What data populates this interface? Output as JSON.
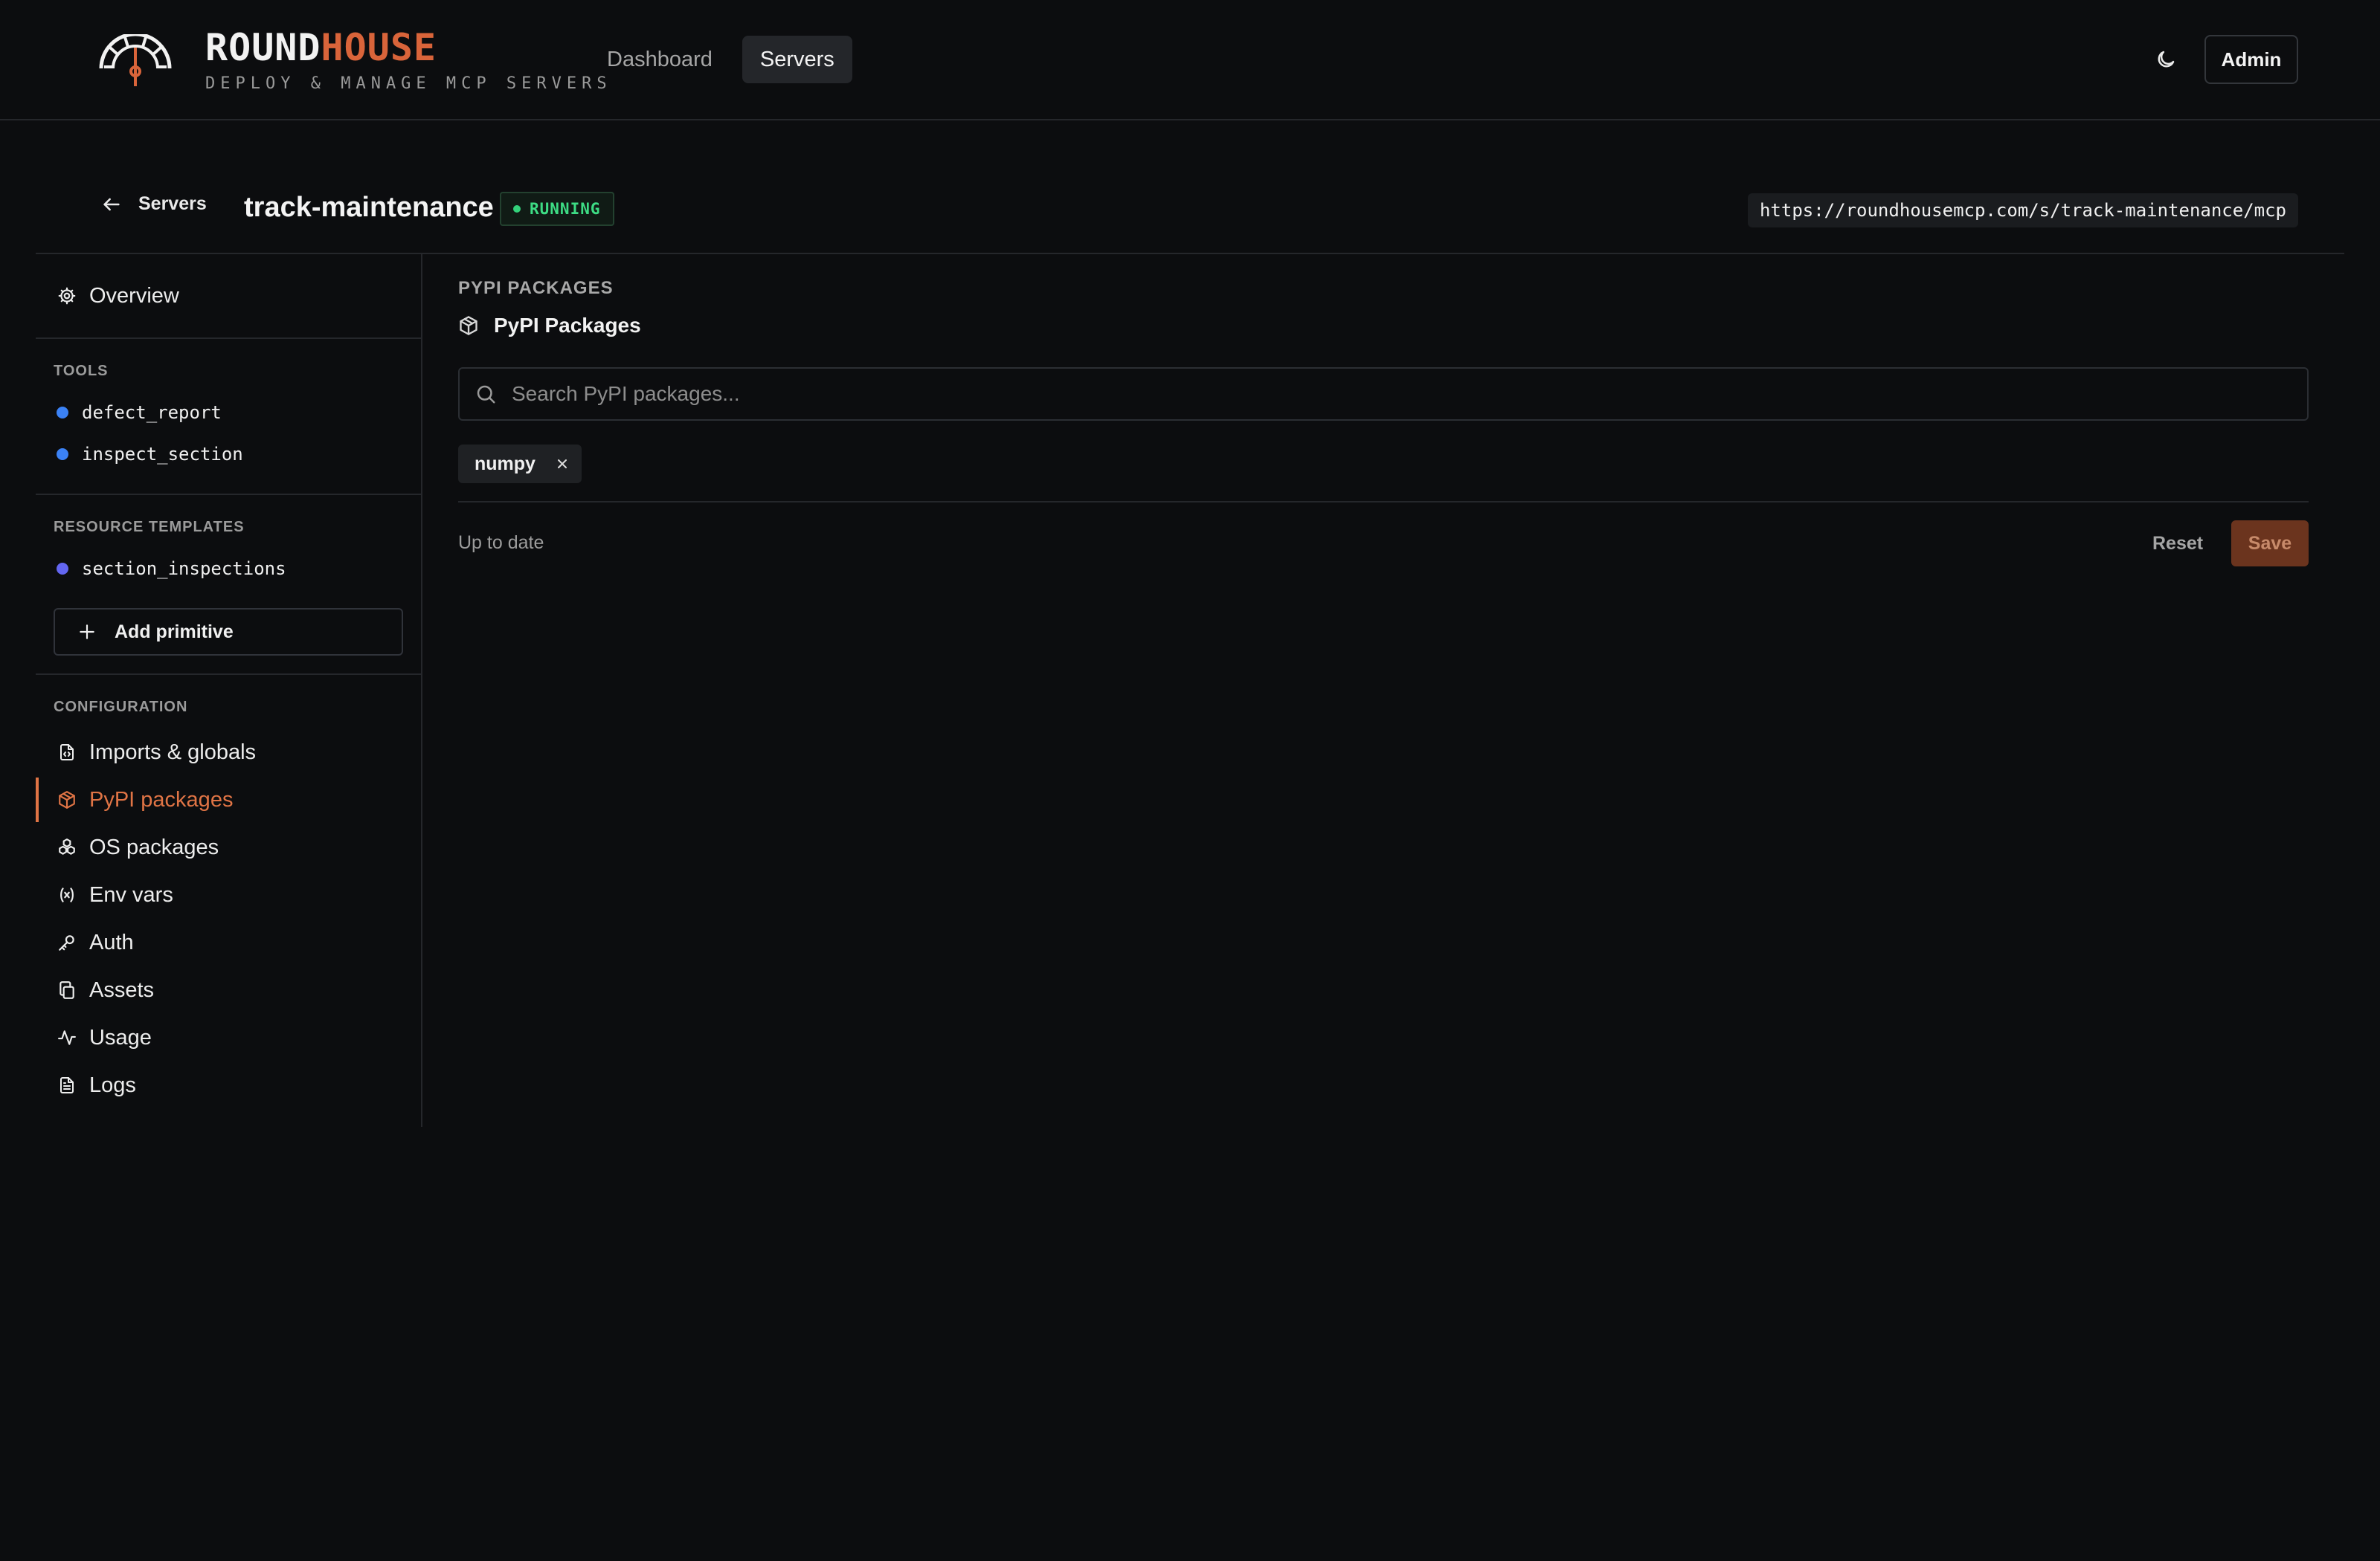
{
  "brand": {
    "word_a": "ROUND",
    "word_b": "HOUSE",
    "tagline": "DEPLOY & MANAGE MCP SERVERS",
    "accent_color": "#d9643a"
  },
  "nav": {
    "items": [
      {
        "label": "Dashboard"
      },
      {
        "label": "Servers"
      }
    ],
    "active": "Servers"
  },
  "header_actions": {
    "theme_icon": "moon-icon",
    "admin_label": "Admin"
  },
  "server": {
    "back_label": "Servers",
    "name": "track-maintenance",
    "status": "RUNNING",
    "status_color": "#3ddc84",
    "url": "https://roundhousemcp.com/s/track-maintenance/mcp"
  },
  "sidebar": {
    "overview_label": "Overview",
    "tools_heading": "TOOLS",
    "tools": [
      {
        "name": "defect_report"
      },
      {
        "name": "inspect_section"
      }
    ],
    "resource_templates_heading": "RESOURCE TEMPLATES",
    "resource_templates": [
      {
        "name": "section_inspections"
      }
    ],
    "add_primitive_label": "Add primitive",
    "configuration_heading": "CONFIGURATION",
    "config_items": [
      {
        "label": "Imports & globals",
        "icon": "file-code-icon"
      },
      {
        "label": "PyPI packages",
        "icon": "package-icon",
        "active": true
      },
      {
        "label": "OS packages",
        "icon": "boxes-icon"
      },
      {
        "label": "Env vars",
        "icon": "variable-icon"
      },
      {
        "label": "Auth",
        "icon": "key-icon"
      },
      {
        "label": "Assets",
        "icon": "copy-icon"
      },
      {
        "label": "Usage",
        "icon": "activity-icon"
      },
      {
        "label": "Logs",
        "icon": "file-text-icon"
      }
    ]
  },
  "main": {
    "eyebrow": "PYPI PACKAGES",
    "title": "PyPI Packages",
    "search_placeholder": "Search PyPI packages...",
    "packages": [
      {
        "name": "numpy"
      }
    ],
    "status_text": "Up to date",
    "reset_label": "Reset",
    "save_label": "Save"
  }
}
